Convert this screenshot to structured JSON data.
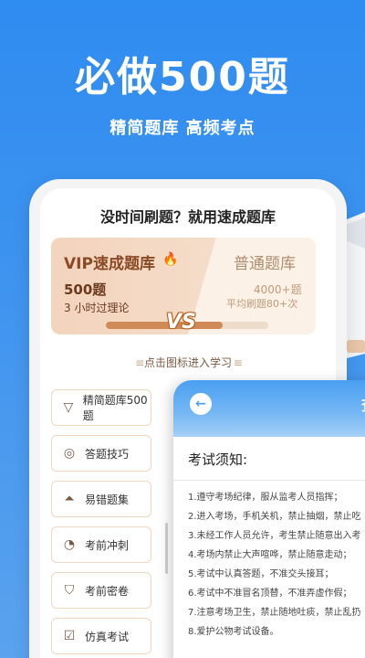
{
  "headline": "必做500题",
  "subline": "精简题库 高频考点",
  "screen": {
    "title": "没时间刷题？就用速成题库",
    "vip": {
      "title": "VIP速成题库",
      "count": "500题",
      "desc": "3 小时过理论"
    },
    "normal": {
      "title": "普通题库",
      "count": "4000+题",
      "desc": "平均刷题80+次"
    },
    "vs_label": "VS",
    "progress": 0.72,
    "hint": "点击图标进入学习",
    "menu": [
      {
        "label": "精简题库500题",
        "icon": "funnel-icon"
      },
      {
        "label": "答题技巧",
        "icon": "lightbulb-icon"
      },
      {
        "label": "易错题集",
        "icon": "alarm-icon"
      },
      {
        "label": "考前冲刺",
        "icon": "gauge-icon"
      },
      {
        "label": "考前密卷",
        "icon": "shield-icon"
      },
      {
        "label": "仿真考试",
        "icon": "checklist-icon"
      }
    ]
  },
  "notice": {
    "header_partial": "查",
    "title": "考试须知:",
    "rules": [
      "1.遵守考场纪律，服从监考人员指挥；",
      "2.进入考场，手机关机，禁止抽烟，禁止吃",
      "3.未经工作人员允许，考生禁止随意出入考",
      "4.考场内禁止大声喧哗，禁止随意走动；",
      "5.考试中认真答题，不准交头接耳；",
      "6.考试中不准冒名顶替，不准弄虚作假；",
      "7.注意考场卫生，禁止随地吐痰，禁止乱扔",
      "8.爱护公物考试设备。"
    ]
  },
  "colors": {
    "background": "#2f8cf0",
    "vip_accent": "#8b4a26",
    "menu_border": "#efd7c1"
  }
}
